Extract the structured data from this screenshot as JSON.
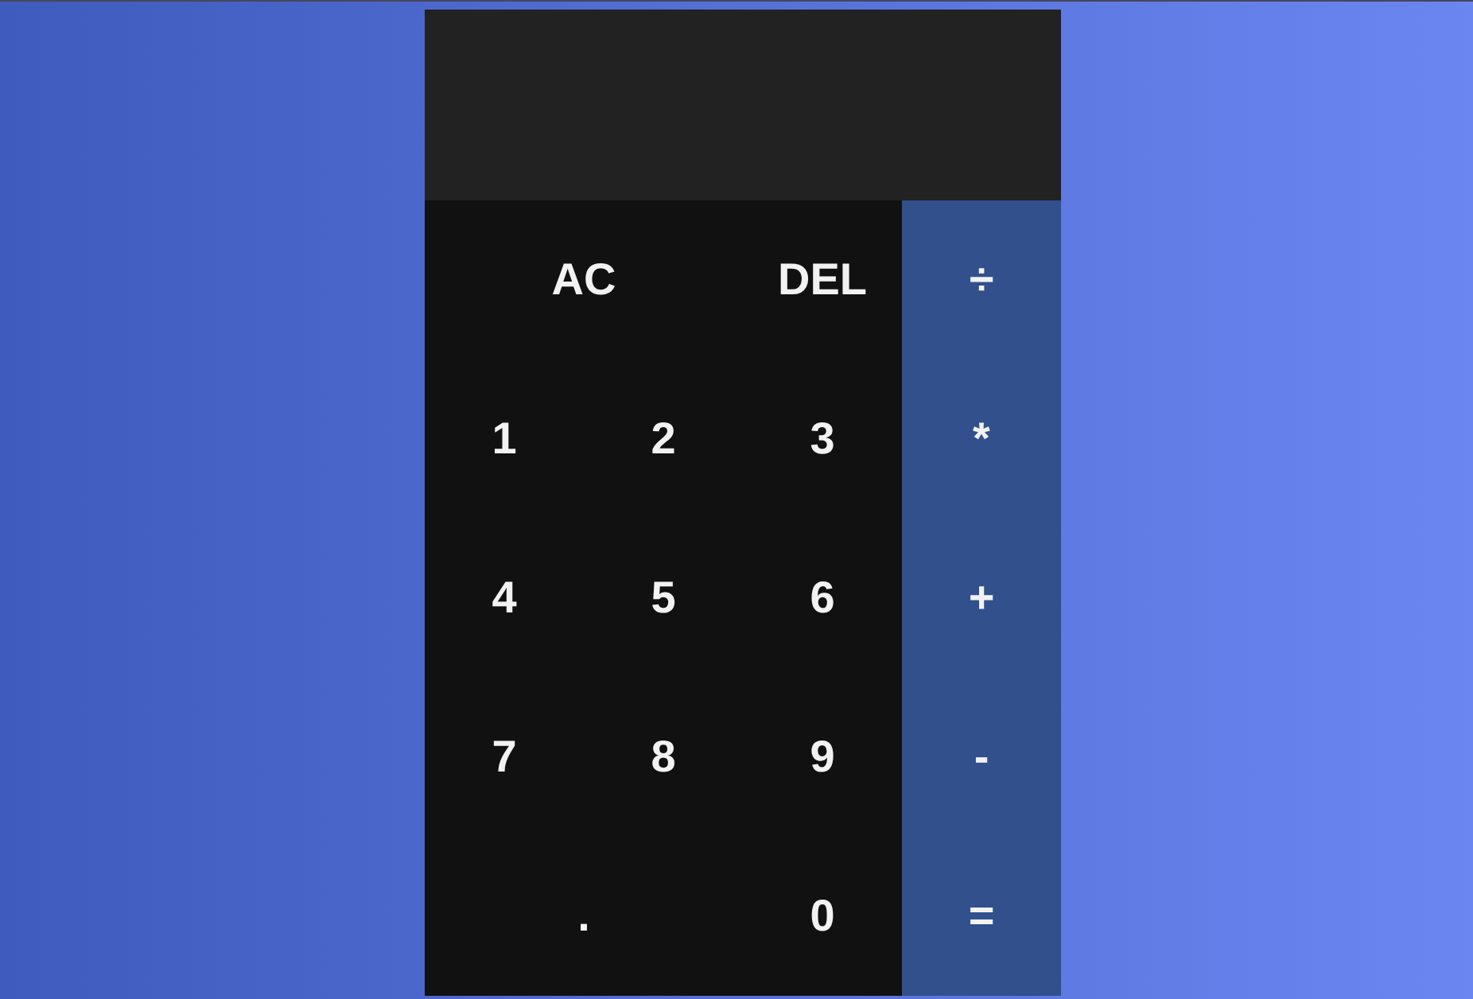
{
  "keys": [
    {
      "label": "AC",
      "kind": "function",
      "wide": true
    },
    {
      "label": "DEL",
      "kind": "function",
      "wide": false
    },
    {
      "label": "÷",
      "kind": "operator",
      "wide": false
    },
    {
      "label": "1",
      "kind": "digit",
      "wide": false
    },
    {
      "label": "2",
      "kind": "digit",
      "wide": false
    },
    {
      "label": "3",
      "kind": "digit",
      "wide": false
    },
    {
      "label": "*",
      "kind": "operator",
      "wide": false
    },
    {
      "label": "4",
      "kind": "digit",
      "wide": false
    },
    {
      "label": "5",
      "kind": "digit",
      "wide": false
    },
    {
      "label": "6",
      "kind": "digit",
      "wide": false
    },
    {
      "label": "+",
      "kind": "operator",
      "wide": false
    },
    {
      "label": "7",
      "kind": "digit",
      "wide": false
    },
    {
      "label": "8",
      "kind": "digit",
      "wide": false
    },
    {
      "label": "9",
      "kind": "digit",
      "wide": false
    },
    {
      "label": "-",
      "kind": "operator",
      "wide": false
    },
    {
      "label": ".",
      "kind": "digit",
      "wide": true
    },
    {
      "label": "0",
      "kind": "digit",
      "wide": false
    },
    {
      "label": "=",
      "kind": "operator",
      "wide": false
    }
  ]
}
